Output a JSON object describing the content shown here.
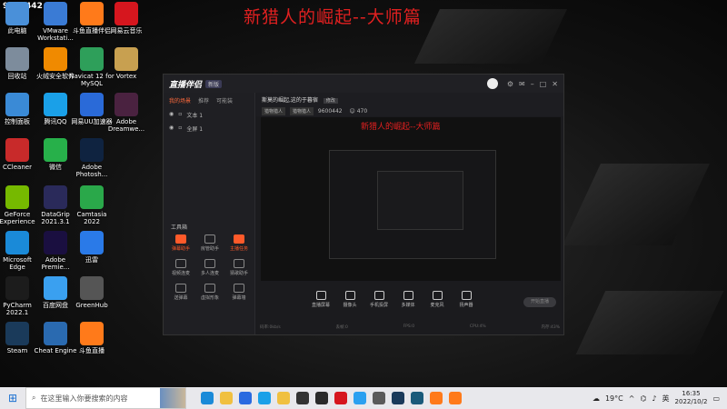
{
  "overlay": {
    "stream_title": "新猎人的崛起--大师篇",
    "channel_id": "9600442"
  },
  "desktop": {
    "icons": [
      {
        "label": "此电脑",
        "icon": "computer-icon",
        "color": "#4a90d9"
      },
      {
        "label": "VMware Workstati...",
        "icon": "vmware-icon",
        "color": "#3a7bd5"
      },
      {
        "label": "斗鱼直播伴侣",
        "icon": "douyu-icon",
        "color": "#ff7a1a"
      },
      {
        "label": "网易云音乐",
        "icon": "netease-music-icon",
        "color": "#d6161e"
      },
      {
        "label": "回收站",
        "icon": "recycle-bin-icon",
        "color": "#7d8c9c"
      },
      {
        "label": "火绒安全软件",
        "icon": "huorong-icon",
        "color": "#f08a00"
      },
      {
        "label": "Navicat 12 for MySQL",
        "icon": "navicat-icon",
        "color": "#2e9f5a"
      },
      {
        "label": "Vortex",
        "icon": "vortex-icon",
        "color": "#c8a050"
      },
      {
        "label": "控制面板",
        "icon": "control-panel-icon",
        "color": "#3a8ad6"
      },
      {
        "label": "腾讯QQ",
        "icon": "qq-icon",
        "color": "#1aa0e8"
      },
      {
        "label": "网易UU加速器",
        "icon": "uu-icon",
        "color": "#2a6ad8"
      },
      {
        "label": "Adobe Dreamwe...",
        "icon": "dreamweaver-icon",
        "color": "#4a2240"
      },
      {
        "label": "CCleaner",
        "icon": "ccleaner-icon",
        "color": "#c82a2a"
      },
      {
        "label": "微信",
        "icon": "wechat-icon",
        "color": "#27b04a"
      },
      {
        "label": "Adobe Photosh...",
        "icon": "photoshop-icon",
        "color": "#0f2340"
      },
      {
        "label": "GeForce Experience",
        "icon": "geforce-icon",
        "color": "#76b900"
      },
      {
        "label": "DataGrip 2021.3.1",
        "icon": "datagrip-icon",
        "color": "#2a2a5a"
      },
      {
        "label": "Camtasia 2022",
        "icon": "camtasia-icon",
        "color": "#2aa84a"
      },
      {
        "label": "Microsoft Edge",
        "icon": "edge-icon",
        "color": "#1a8ad8"
      },
      {
        "label": "Adobe Premie...",
        "icon": "premiere-icon",
        "color": "#1a0f40"
      },
      {
        "label": "迅雷",
        "icon": "xunlei-icon",
        "color": "#2a7ae8"
      },
      {
        "label": "PyCharm 2022.1",
        "icon": "pycharm-icon",
        "color": "#1c1c1c"
      },
      {
        "label": "百度网盘",
        "icon": "baidu-netdisk-icon",
        "color": "#3aa0f0"
      },
      {
        "label": "GreenHub",
        "icon": "greenhub-icon",
        "color": "#555"
      },
      {
        "label": "Steam",
        "icon": "steam-icon",
        "color": "#1a3a5a"
      },
      {
        "label": "Cheat Engine",
        "icon": "cheat-engine-icon",
        "color": "#2a6ab0"
      },
      {
        "label": "斗鱼直播",
        "icon": "douyu-live-icon",
        "color": "#ff7a1a"
      }
    ]
  },
  "app": {
    "logo": "直播伴侣",
    "version": "新版",
    "scene_tabs": [
      "我的场景",
      "推荐",
      "可能装"
    ],
    "scenes": [
      "文本 1",
      "全屏 1"
    ],
    "toolbox_title": "工具箱",
    "tools": [
      {
        "label": "弹幕助手",
        "hot": true
      },
      {
        "label": "房管助手",
        "hot": false
      },
      {
        "label": "主播任务",
        "hot": true
      },
      {
        "label": "视频连麦",
        "hot": false
      },
      {
        "label": "多人连麦",
        "hot": false
      },
      {
        "label": "猜歌助手",
        "hot": false
      },
      {
        "label": "送弹幕",
        "hot": false
      },
      {
        "label": "虚拟形象",
        "hot": false
      },
      {
        "label": "弹幕墙",
        "hot": false
      }
    ],
    "room_title": "斯莫的崛起,这的于暮宿",
    "edit_label": "修改",
    "tags": [
      "猎物猎人",
      "猎物猎人"
    ],
    "room_id_label": "9600442",
    "viewers": "470",
    "inner_title": "新猎人的崛起--大师篇",
    "controls": [
      "直播屏幕",
      "摄像头",
      "手机投屏",
      "多媒体",
      "麦克风",
      "扬声器"
    ],
    "start_label": "开始直播",
    "status": [
      "码率:0kb/s",
      "丢帧:0",
      "FPS:0",
      "CPU:4%",
      "内存:43%"
    ]
  },
  "taskbar": {
    "search_placeholder": "在这里输入你要搜索的内容",
    "weather": "19°C",
    "ime": "英",
    "time": "16:35",
    "date": "2022/10/2",
    "apps": [
      "#1a8ad8",
      "#f0c040",
      "#2a6ae0",
      "#1aa0e8",
      "#f0c040",
      "#333",
      "#2a2a2a",
      "#d6161e",
      "#2aa0f0",
      "#5a5a5a",
      "#1a3a5a",
      "#1a5a7a",
      "#ff7a1a",
      "#ff7a1a"
    ]
  }
}
